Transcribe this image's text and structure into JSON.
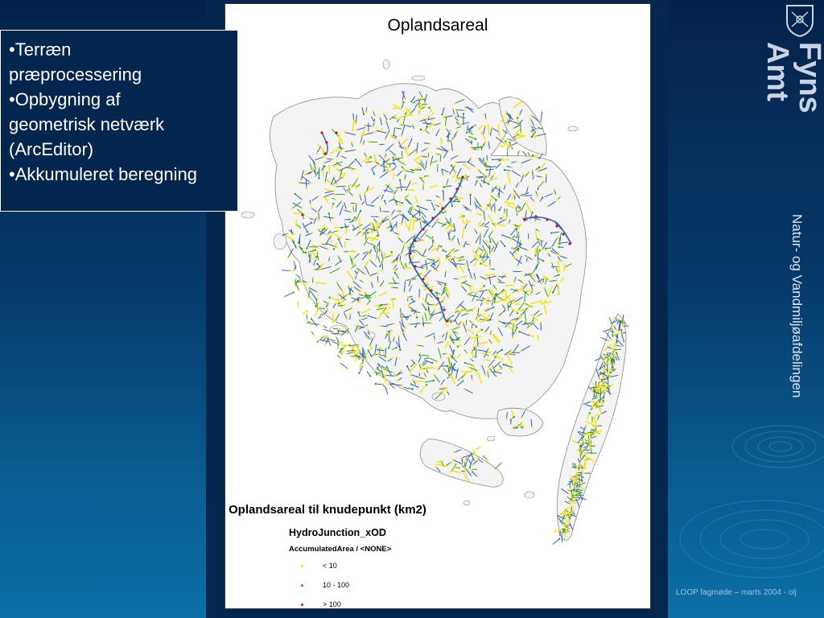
{
  "slide": {
    "bullets": [
      "•Terræn præprocessering",
      "•Opbygning af geometrisk netværk (ArcEditor)",
      "•Akkumuleret beregning"
    ],
    "bullet_lines": [
      "•Terræn",
      "præprocessering",
      "•Opbygning af",
      "geometrisk netværk",
      "(ArcEditor)",
      "•Akkumuleret beregning"
    ],
    "logo": [
      "Fyns",
      "Amt"
    ],
    "department": "Natur- og Vandmiljøafdelingen",
    "footer": "LOOP fagmøde  – marts 2004 - olj"
  },
  "map": {
    "title": "Oplandsareal",
    "legend": {
      "title": "Oplandsareal til knudepunkt (km2)",
      "layer": "HydroJunction_xOD",
      "field": "AccumulatedArea / <NONE>",
      "classes": [
        {
          "label": "< 10",
          "color": "#f2e600"
        },
        {
          "label": "10 - 100",
          "color": "#2aa32a"
        },
        {
          "label": "> 100",
          "color": "#c8102e"
        }
      ]
    },
    "colors": {
      "land": "#f2f3f2",
      "coast": "#8a8a8a",
      "stream": "#2f5fd0"
    }
  }
}
